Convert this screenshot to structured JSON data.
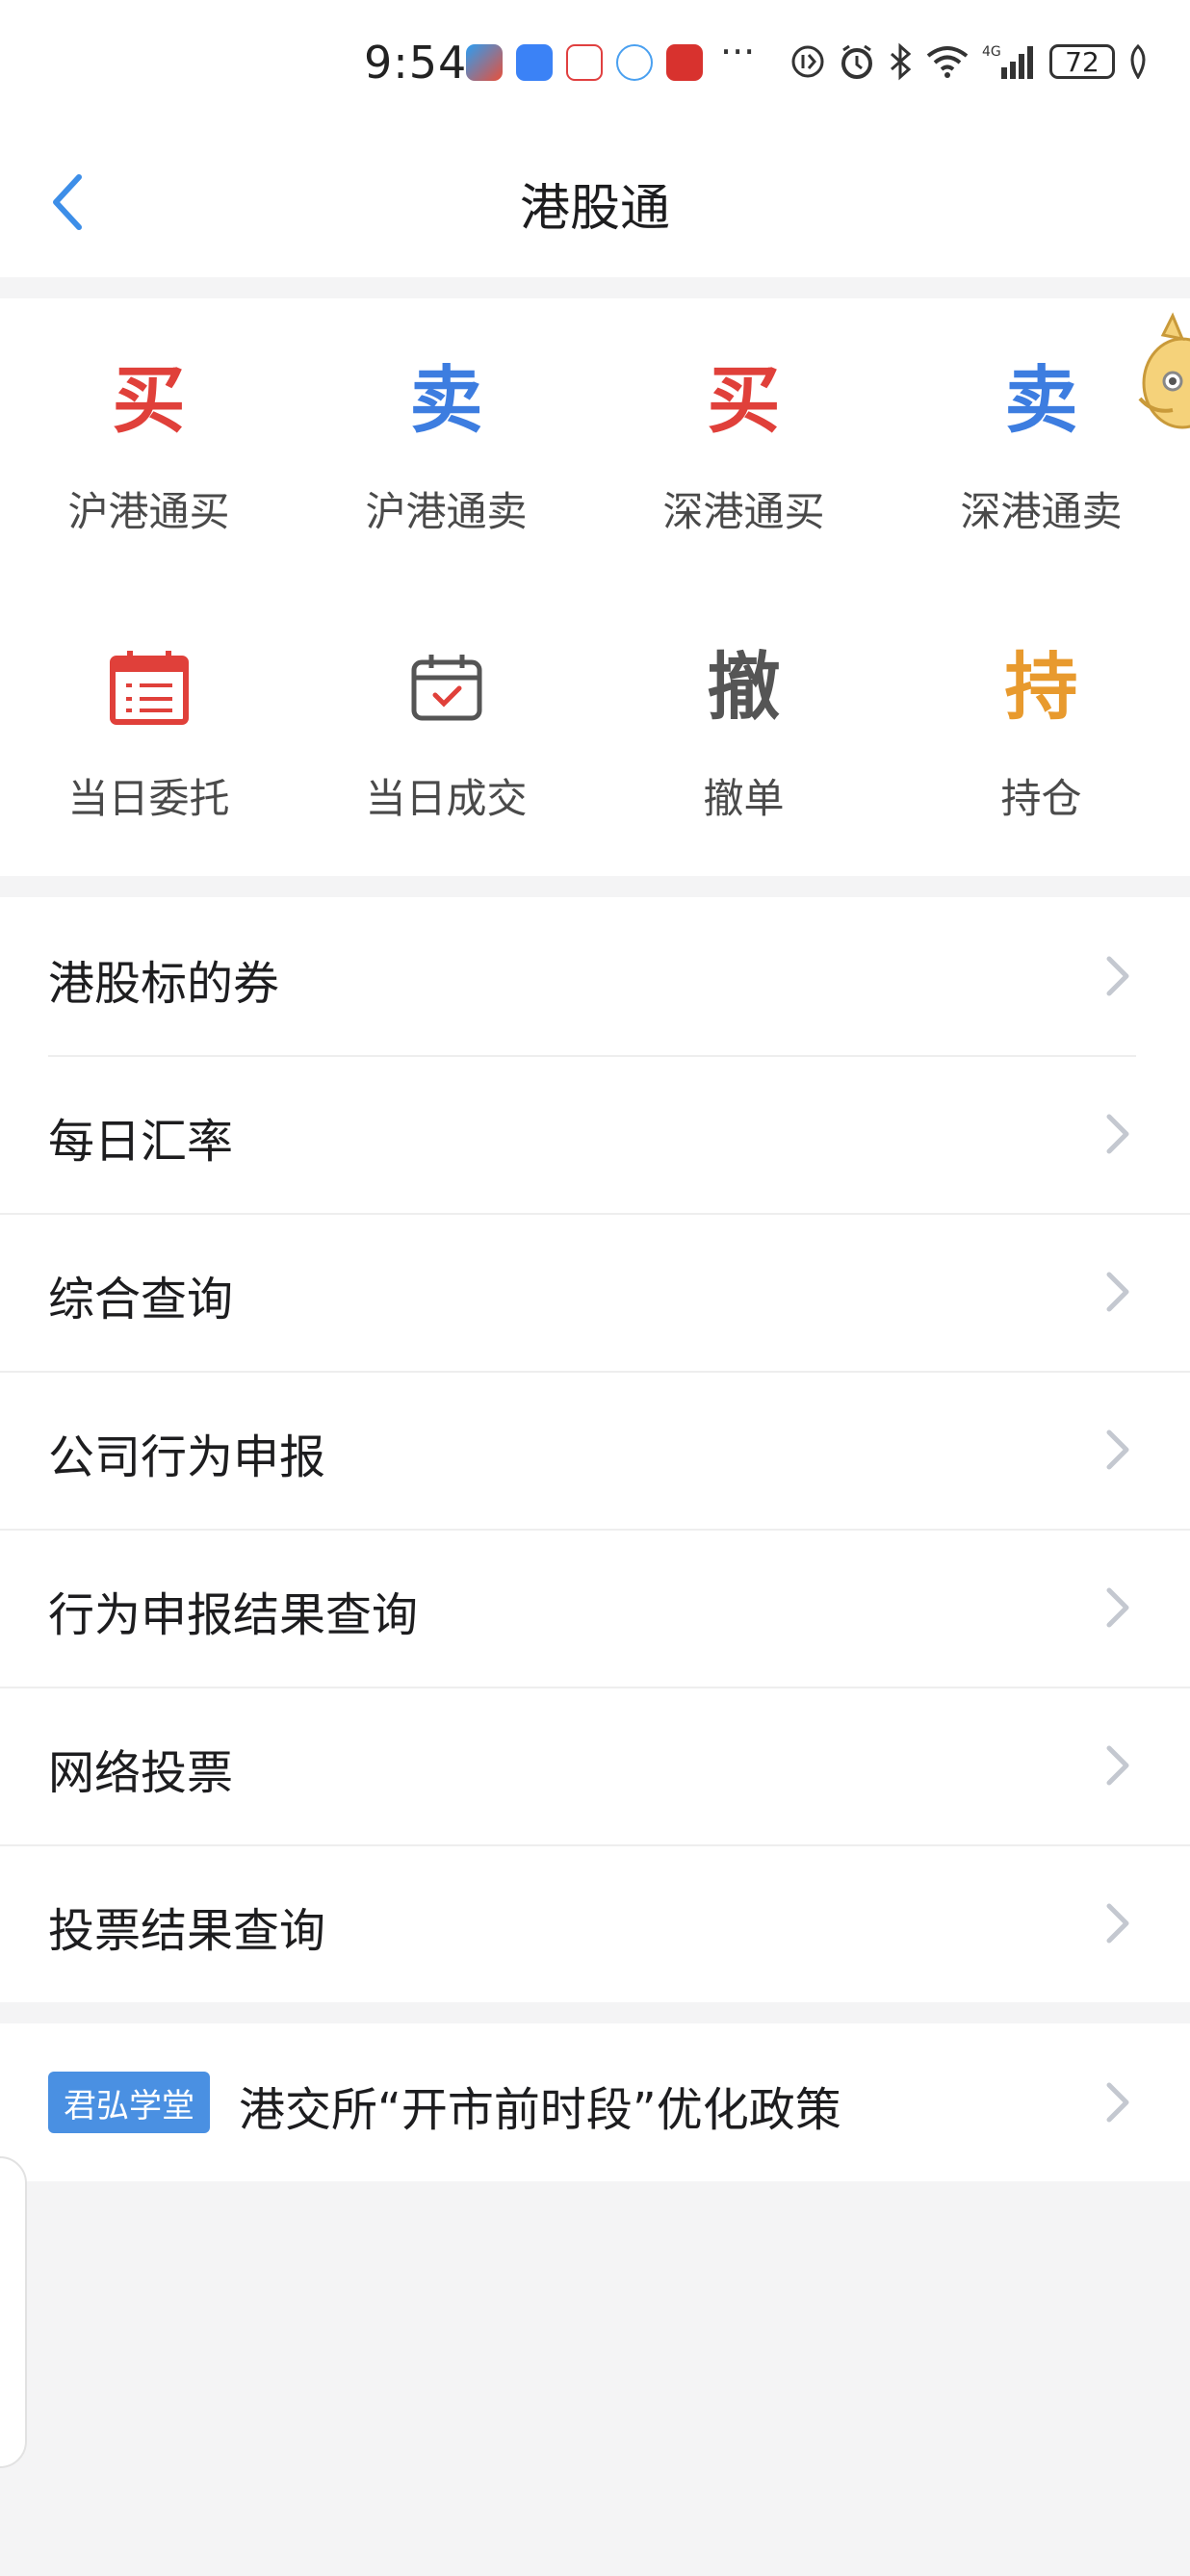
{
  "status_bar": {
    "time": "9:54",
    "battery": "72",
    "icons": [
      "app-notification-icon",
      "alarm-icon",
      "bluetooth-icon",
      "wifi-icon",
      "4g-signal-icon"
    ]
  },
  "header": {
    "title": "港股通"
  },
  "actions": {
    "row1": [
      {
        "glyph": "买",
        "label": "沪港通买",
        "color": "#e0403a"
      },
      {
        "glyph": "卖",
        "label": "沪港通卖",
        "color": "#3d7de0"
      },
      {
        "glyph": "买",
        "label": "深港通买",
        "color": "#e0403a"
      },
      {
        "glyph": "卖",
        "label": "深港通卖",
        "color": "#3d7de0"
      }
    ],
    "row2": [
      {
        "label": "当日委托",
        "icon": "calendar-list-icon",
        "color": "#e0403a"
      },
      {
        "label": "当日成交",
        "icon": "calendar-check-icon",
        "color": "#555555"
      },
      {
        "glyph": "撤",
        "label": "撤单",
        "color": "#555555"
      },
      {
        "glyph": "持",
        "label": "持仓",
        "color": "#e89a2e"
      }
    ]
  },
  "menu": {
    "items": [
      {
        "label": "港股标的券"
      },
      {
        "label": "每日汇率"
      },
      {
        "label": "综合查询"
      },
      {
        "label": "公司行为申报"
      },
      {
        "label": "行为申报结果查询"
      },
      {
        "label": "网络投票"
      },
      {
        "label": "投票结果查询"
      }
    ]
  },
  "promo": {
    "badge": "君弘学堂",
    "text": "港交所“开市前时段”优化政策"
  }
}
